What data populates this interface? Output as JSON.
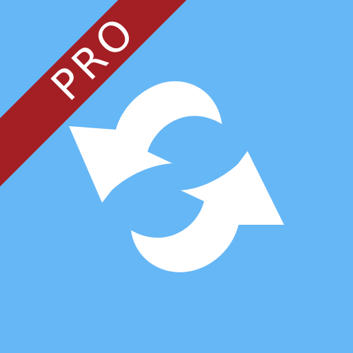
{
  "app_icon": {
    "icon": "sync-icon",
    "badge": {
      "label": "PRO"
    },
    "colors": {
      "background": "#66b7f6",
      "badge": "#a31f24",
      "arrows": "#ffffff",
      "badge_text": "#ffffff"
    }
  }
}
